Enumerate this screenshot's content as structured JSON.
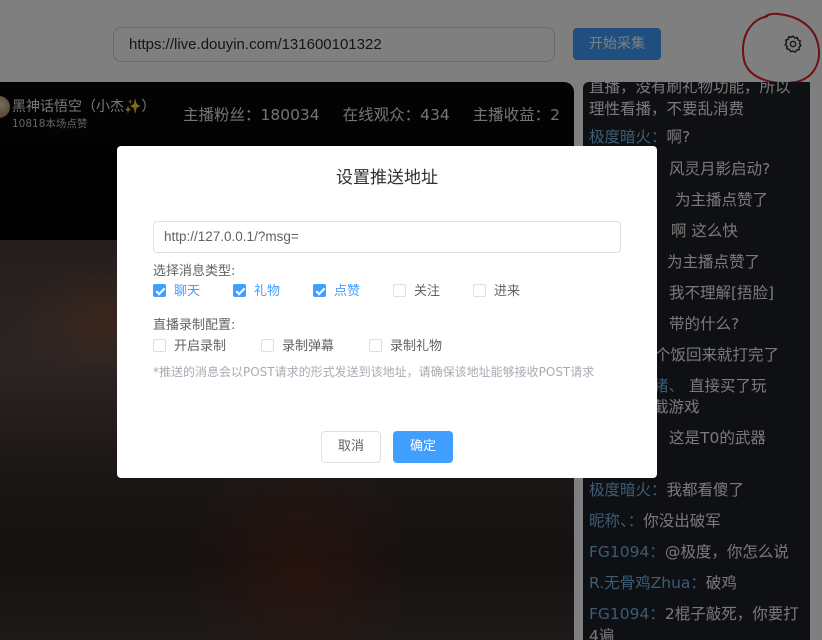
{
  "toolbar": {
    "url_value": "https://live.douyin.com/131600101322",
    "start_label": "开始采集",
    "settings_icon": "gear-icon"
  },
  "streamer": {
    "name": "黑神话悟空（小杰✨）",
    "likes": "10818本场点赞",
    "fans": "主播粉丝：180034",
    "viewers": "在线观众：434",
    "income": "主播收益：2"
  },
  "chat": [
    {
      "user": "",
      "text": "直播，没有刷礼物功能，所以理性看播，不要乱消费"
    },
    {
      "user": "极度暗火：",
      "text": "啊?"
    },
    {
      "user": "",
      "text": "风灵月影启动?"
    },
    {
      "user": "",
      "text": "为主播点赞了"
    },
    {
      "user": "",
      "text": "啊 这么快"
    },
    {
      "user": "",
      "text": "为主播点赞了"
    },
    {
      "user": "",
      "text": "我不理解[捂脸]"
    },
    {
      "user": "",
      "text": "带的什么?"
    },
    {
      "user": "",
      "text": "个饭回来就打完了"
    },
    {
      "user": "猪、",
      "text": "直接买了玩"
    },
    {
      "user": "",
      "text": "截游戏"
    },
    {
      "user": "",
      "text": "这是T0的武器"
    },
    {
      "user": "极度暗火：",
      "text": "我都看傻了"
    },
    {
      "user": "昵称、：",
      "text": "你没出破军"
    },
    {
      "user": "FG1094：",
      "text": "@极度，你怎么说"
    },
    {
      "user": "R.无骨鸡Zhua：",
      "text": "破鸡"
    },
    {
      "user": "FG1094：",
      "text": "2棍子敲死，你要打4遍"
    }
  ],
  "dialog": {
    "title": "设置推送地址",
    "address_value": "http://127.0.0.1/?msg=",
    "msg_type_label": "选择消息类型:",
    "msg_types": [
      {
        "label": "聊天",
        "checked": true
      },
      {
        "label": "礼物",
        "checked": true
      },
      {
        "label": "点赞",
        "checked": true
      },
      {
        "label": "关注",
        "checked": false
      },
      {
        "label": "进来",
        "checked": false
      }
    ],
    "record_label": "直播录制配置:",
    "record_options": [
      {
        "label": "开启录制",
        "checked": false
      },
      {
        "label": "录制弹幕",
        "checked": false
      },
      {
        "label": "录制礼物",
        "checked": false
      }
    ],
    "note": "*推送的消息会以POST请求的形式发送到该地址，请确保该地址能够接收POST请求",
    "cancel_label": "取消",
    "ok_label": "确定"
  },
  "colors": {
    "accent": "#409eff",
    "chat_username": "#79b8ea",
    "annotation": "#e02020"
  }
}
